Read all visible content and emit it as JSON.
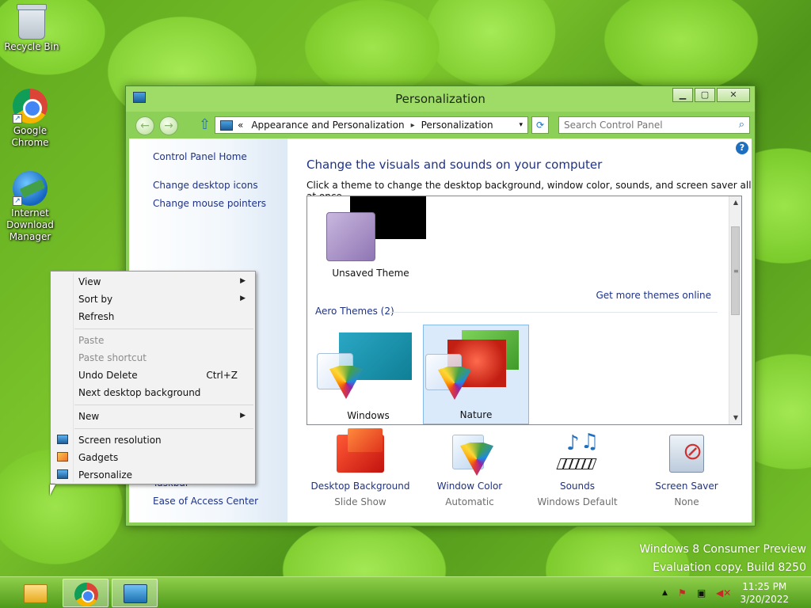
{
  "desktop": {
    "icons": [
      {
        "label": "Recycle Bin"
      },
      {
        "label": "Google Chrome"
      },
      {
        "label": "Internet Download Manager"
      }
    ],
    "watermark": {
      "line1": "Windows 8 Consumer Preview",
      "line2": "Evaluation copy. Build 8250"
    }
  },
  "window": {
    "title": "Personalization",
    "buttons": {
      "minimize": "▁",
      "maximize": "▢",
      "close": "✕"
    },
    "address": {
      "prefix": "«",
      "crumbs": [
        "Appearance and Personalization",
        "Personalization"
      ],
      "separator": "▸",
      "dropdown": "▾"
    },
    "refresh": "⟳",
    "search": {
      "placeholder": "Search Control Panel",
      "icon": "⌕"
    },
    "left_pane": {
      "links": [
        "Control Panel Home",
        "Change desktop icons",
        "Change mouse pointers"
      ],
      "see_also_partial": "Taskbar",
      "ease": "Ease of Access Center"
    },
    "main": {
      "help": "?",
      "heading": "Change the visuals and sounds on your computer",
      "subtext": "Click a theme to change the desktop background, window color, sounds, and screen saver all at once.",
      "unsaved_theme": "Unsaved Theme",
      "more_themes": "Get more themes online",
      "group_label": "Aero Themes (2)",
      "themes": [
        {
          "label": "Windows",
          "selected": false
        },
        {
          "label": "Nature",
          "selected": true
        }
      ],
      "bottom_items": [
        {
          "label": "Desktop Background",
          "sub": "Slide Show"
        },
        {
          "label": "Window Color",
          "sub": "Automatic"
        },
        {
          "label": "Sounds",
          "sub": "Windows Default"
        },
        {
          "label": "Screen Saver",
          "sub": "None"
        }
      ]
    }
  },
  "context_menu": {
    "items": [
      {
        "label": "View",
        "submenu": true
      },
      {
        "label": "Sort by",
        "submenu": true
      },
      {
        "label": "Refresh"
      },
      {
        "label": "Paste",
        "disabled": true
      },
      {
        "label": "Paste shortcut",
        "disabled": true
      },
      {
        "label": "Undo Delete",
        "shortcut": "Ctrl+Z"
      },
      {
        "label": "Next desktop background"
      },
      {
        "label": "New",
        "submenu": true
      },
      {
        "label": "Screen resolution"
      },
      {
        "label": "Gadgets"
      },
      {
        "label": "Personalize"
      }
    ],
    "submenu_arrow": "▶"
  },
  "taskbar": {
    "tray_arrow": "▲",
    "time": "11:25 PM",
    "date": "3/20/2022"
  },
  "colors": {
    "link": "#1e3287",
    "accent_green": "#8dd057",
    "selection": "#dbeafb"
  }
}
